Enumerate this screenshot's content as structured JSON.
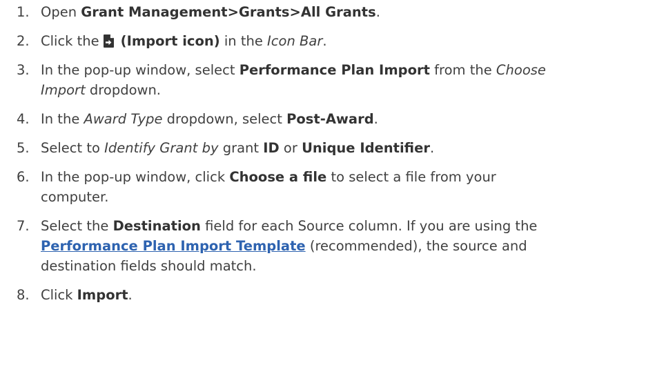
{
  "steps": [
    {
      "number": "1.",
      "segments": [
        {
          "text": "Open ",
          "style": "plain"
        },
        {
          "text": "Grant Management>Grants>All Grants",
          "style": "bold"
        },
        {
          "text": ".",
          "style": "plain"
        }
      ]
    },
    {
      "number": "2.",
      "segments": [
        {
          "text": "Click the ",
          "style": "plain"
        },
        {
          "icon": "import-icon"
        },
        {
          "text": " (Import icon)",
          "style": "bold"
        },
        {
          "text": " in the ",
          "style": "plain"
        },
        {
          "text": "Icon Bar",
          "style": "italic"
        },
        {
          "text": ".",
          "style": "plain"
        }
      ]
    },
    {
      "number": "3.",
      "segments": [
        {
          "text": "In the pop-up window, select ",
          "style": "plain"
        },
        {
          "text": "Performance Plan Import",
          "style": "bold"
        },
        {
          "text": " from the ",
          "style": "plain"
        },
        {
          "text": "Choose",
          "style": "italic"
        },
        {
          "break": true
        },
        {
          "text": "Import",
          "style": "italic"
        },
        {
          "text": " dropdown.",
          "style": "plain"
        }
      ]
    },
    {
      "number": "4.",
      "segments": [
        {
          "text": "In the ",
          "style": "plain"
        },
        {
          "text": "Award Type",
          "style": "italic"
        },
        {
          "text": " dropdown, select ",
          "style": "plain"
        },
        {
          "text": "Post-Award",
          "style": "bold"
        },
        {
          "text": ".",
          "style": "plain"
        }
      ]
    },
    {
      "number": "5.",
      "segments": [
        {
          "text": "Select to ",
          "style": "plain"
        },
        {
          "text": "Identify Grant by",
          "style": "italic"
        },
        {
          "text": " grant ",
          "style": "plain"
        },
        {
          "text": "ID",
          "style": "bold"
        },
        {
          "text": " or ",
          "style": "plain"
        },
        {
          "text": "Unique Identifier",
          "style": "bold"
        },
        {
          "text": ".",
          "style": "plain"
        }
      ]
    },
    {
      "number": "6.",
      "segments": [
        {
          "text": "In the pop-up window, click ",
          "style": "plain"
        },
        {
          "text": "Choose a file",
          "style": "bold"
        },
        {
          "text": " to select a file from your",
          "style": "plain"
        },
        {
          "break": true
        },
        {
          "text": "computer.",
          "style": "plain"
        }
      ]
    },
    {
      "number": "7.",
      "segments": [
        {
          "text": "Select the ",
          "style": "plain"
        },
        {
          "text": "Destination",
          "style": "bold"
        },
        {
          "text": " field for each Source column. If you are using the",
          "style": "plain"
        },
        {
          "break": true
        },
        {
          "text": "Performance Plan Import Template",
          "style": "link"
        },
        {
          "text": " (recommended), the source and",
          "style": "plain"
        },
        {
          "break": true
        },
        {
          "text": "destination fields should match.",
          "style": "plain"
        }
      ]
    },
    {
      "number": "8.",
      "segments": [
        {
          "text": "Click ",
          "style": "plain"
        },
        {
          "text": "Import",
          "style": "bold"
        },
        {
          "text": ".",
          "style": "plain"
        }
      ]
    }
  ],
  "colors": {
    "text": "#404040",
    "bold_text": "#333333",
    "link": "#2e63b0"
  }
}
